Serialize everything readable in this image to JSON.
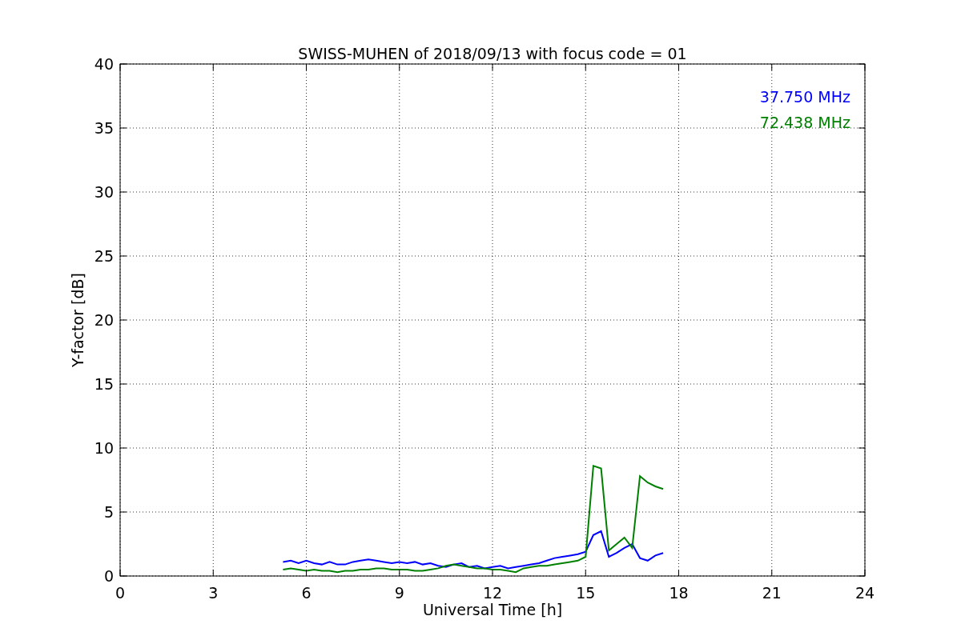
{
  "chart_data": {
    "type": "line",
    "title": "SWISS-MUHEN of 2018/09/13 with focus code = 01",
    "xlabel": "Universal Time [h]",
    "ylabel": "Y-factor [dB]",
    "x": [
      5.25,
      5.5,
      5.75,
      6,
      6.25,
      6.5,
      6.75,
      7,
      7.25,
      7.5,
      7.75,
      8,
      8.25,
      8.5,
      8.75,
      9,
      9.25,
      9.5,
      9.75,
      10,
      10.25,
      10.5,
      10.75,
      11,
      11.25,
      11.5,
      11.75,
      12,
      12.25,
      12.5,
      12.75,
      13,
      13.25,
      13.5,
      13.75,
      14,
      14.25,
      14.5,
      14.75,
      15,
      15.25,
      15.5,
      15.75,
      16,
      16.25,
      16.5,
      16.75,
      17,
      17.25,
      17.5
    ],
    "series": [
      {
        "name": "37.750 MHz",
        "color": "#0000ff",
        "values": [
          1.1,
          1.2,
          1.0,
          1.2,
          1.0,
          0.9,
          1.1,
          0.9,
          0.9,
          1.1,
          1.2,
          1.3,
          1.2,
          1.1,
          1.0,
          1.1,
          1.0,
          1.1,
          0.9,
          1.0,
          0.8,
          0.7,
          0.9,
          1.0,
          0.7,
          0.8,
          0.6,
          0.7,
          0.8,
          0.6,
          0.7,
          0.8,
          0.9,
          1.0,
          1.2,
          1.4,
          1.5,
          1.6,
          1.7,
          1.9,
          3.2,
          3.5,
          1.5,
          1.8,
          2.2,
          2.5,
          1.4,
          1.2,
          1.6,
          1.8
        ]
      },
      {
        "name": "72.438 MHz",
        "color": "#008000",
        "values": [
          0.5,
          0.6,
          0.5,
          0.4,
          0.5,
          0.4,
          0.4,
          0.3,
          0.4,
          0.4,
          0.5,
          0.5,
          0.6,
          0.6,
          0.5,
          0.5,
          0.5,
          0.4,
          0.4,
          0.5,
          0.6,
          0.8,
          0.9,
          0.8,
          0.7,
          0.6,
          0.6,
          0.5,
          0.5,
          0.4,
          0.3,
          0.6,
          0.7,
          0.8,
          0.8,
          0.9,
          1.0,
          1.1,
          1.2,
          1.5,
          8.6,
          8.4,
          2.0,
          2.5,
          3.0,
          2.2,
          7.8,
          7.3,
          7.0,
          6.8
        ]
      }
    ],
    "xlim": [
      0,
      24
    ],
    "ylim": [
      0,
      40
    ],
    "xticks": [
      0,
      3,
      6,
      9,
      12,
      15,
      18,
      21,
      24
    ],
    "yticks": [
      0,
      5,
      10,
      15,
      20,
      25,
      30,
      35,
      40
    ],
    "grid": true
  }
}
